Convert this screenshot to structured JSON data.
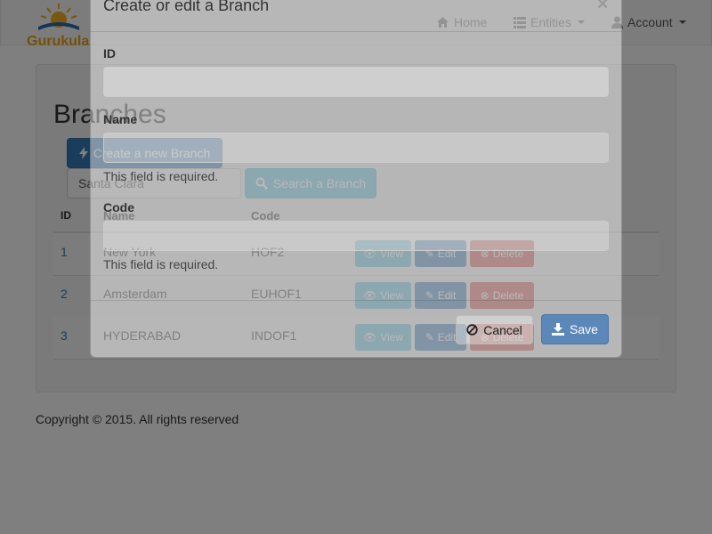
{
  "navbar": {
    "brand": "Gurukula",
    "home": "Home",
    "entities": "Entities",
    "account": "Account"
  },
  "page": {
    "title": "Branches",
    "create_button": "Create a new Branch",
    "search_value": "Santa Clara",
    "search_button": "Search a Branch"
  },
  "table": {
    "headers": {
      "id": "ID",
      "name": "Name",
      "code": "Code"
    },
    "rows": [
      {
        "id": "1",
        "name": "New York",
        "code": "HOF2"
      },
      {
        "id": "2",
        "name": "Amsterdam",
        "code": "EUHOF1"
      },
      {
        "id": "3",
        "name": "HYDERABAD",
        "code": "INDOF1"
      }
    ],
    "actions": {
      "view": "View",
      "edit": "Edit",
      "delete": "Delete"
    }
  },
  "footer": {
    "text": "Copyright © 2015. All rights reserved"
  },
  "modal": {
    "title": "Create or edit a Branch",
    "close": "×",
    "id_label": "ID",
    "id_value": "",
    "name_label": "Name",
    "name_value": "",
    "name_error": "This field is required.",
    "code_label": "Code",
    "code_value": "",
    "code_error": "This field is required.",
    "cancel": "Cancel",
    "save": "Save"
  },
  "colors": {
    "primary": "#337ab7",
    "info": "#5bc0de",
    "danger": "#d9534f",
    "brand": "#e8a317"
  }
}
